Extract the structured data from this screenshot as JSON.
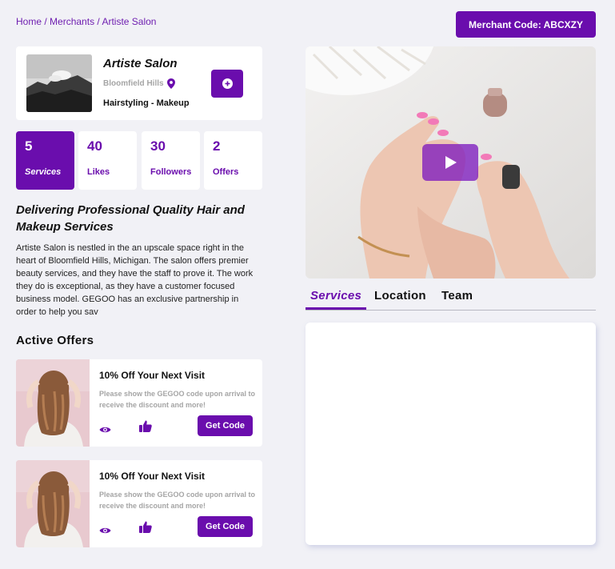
{
  "breadcrumb": {
    "home": "Home",
    "merchants": "Merchants",
    "current": "Artiste Salon",
    "separator": "/"
  },
  "merchant_code_label": "Merchant Code: ABCXZY",
  "profile": {
    "name": "Artiste Salon",
    "location": "Bloomfield Hills",
    "category": "Hairstyling - Makeup"
  },
  "stats": [
    {
      "value": "5",
      "label": "Services"
    },
    {
      "value": "40",
      "label": "Likes"
    },
    {
      "value": "30",
      "label": "Followers"
    },
    {
      "value": "2",
      "label": "Offers"
    }
  ],
  "headline": "Delivering Professional Quality Hair and Makeup Services",
  "description": "Artiste Salon is nestled in the an upscale space right in the heart of Bloomfield Hills, Michigan. The salon offers premier beauty services, and they have the staff to prove it. The work they do is exceptional, as they have a customer focused business model. GEGOO has an exclusive partnership in order to help you sav",
  "offers_title": "Active Offers",
  "offers": [
    {
      "title": "10% Off Your Next Visit",
      "desc": "Please show the GEGOO code upon arrival to receive the discount and more!",
      "button": "Get Code"
    },
    {
      "title": "10% Off Your Next Visit",
      "desc": "Please show the GEGOO code upon arrival to receive the discount and more!",
      "button": "Get Code"
    }
  ],
  "tabs": [
    {
      "label": "Services"
    },
    {
      "label": "Location"
    },
    {
      "label": "Team"
    }
  ],
  "colors": {
    "accent": "#6a0dad",
    "background": "#f1f1f6"
  }
}
